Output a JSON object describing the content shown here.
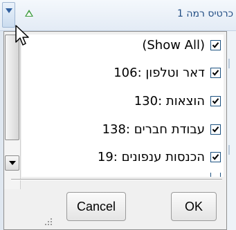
{
  "header": {
    "title": "כרטיס רמה 1",
    "dropdown_icon": "chevron-down-icon",
    "sort_icon": "sort-ascending-icon"
  },
  "filter_list": {
    "items": [
      {
        "label": "(Show All)",
        "checked": true
      },
      {
        "label": "106: דאר וטלפון",
        "checked": true
      },
      {
        "label": "130: הוצאות",
        "checked": true
      },
      {
        "label": "138: עבודת חברים",
        "checked": true
      },
      {
        "label": "19: הכנסות ענפונים",
        "checked": true
      }
    ]
  },
  "buttons": {
    "cancel_label": "Cancel",
    "ok_label": "OK"
  },
  "colors": {
    "header_text": "#1f4b82",
    "checkbox_border": "#1c5180",
    "checkmark": "#000000",
    "sort_icon": "#3a9a3a"
  }
}
